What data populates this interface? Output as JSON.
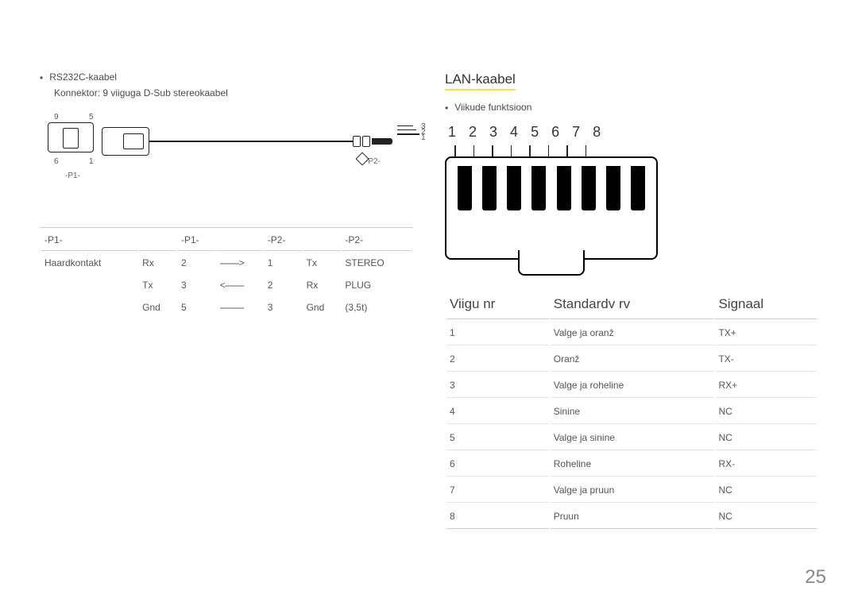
{
  "left": {
    "bullet1": "RS232C-kaabel",
    "sub1": "Konnektor: 9 viiguga D-Sub stereokaabel",
    "diagram": {
      "n9": "9",
      "n5": "5",
      "n6": "6",
      "n1": "1",
      "p1": "-P1-",
      "p2": "-P2-",
      "lead3": "3",
      "lead2": "2",
      "lead1": "1"
    },
    "pin_headers": [
      "-P1-",
      "",
      "-P1-",
      "",
      "-P2-",
      "",
      "-P2-"
    ],
    "pin_rows": [
      [
        "Haardkontakt",
        "Rx",
        "2",
        "-------->",
        "1",
        "Tx",
        "STEREO"
      ],
      [
        "",
        "Tx",
        "3",
        "<--------",
        "2",
        "Rx",
        "PLUG"
      ],
      [
        "",
        "Gnd",
        "5",
        "----------",
        "3",
        "Gnd",
        "(3,5t)"
      ]
    ]
  },
  "right": {
    "title": "LAN-kaabel",
    "bullet1": "Viikude funktsioon",
    "pin_numbers": [
      "1",
      "2",
      "3",
      "4",
      "5",
      "6",
      "7",
      "8"
    ],
    "table_headers": [
      "Viigu nr",
      "Standardv rv",
      "Signaal"
    ],
    "rows": [
      [
        "1",
        "Valge ja oranž",
        "TX+"
      ],
      [
        "2",
        "Oranž",
        "TX-"
      ],
      [
        "3",
        "Valge ja roheline",
        "RX+"
      ],
      [
        "4",
        "Sinine",
        "NC"
      ],
      [
        "5",
        "Valge ja sinine",
        "NC"
      ],
      [
        "6",
        "Roheline",
        "RX-"
      ],
      [
        "7",
        "Valge ja pruun",
        "NC"
      ],
      [
        "8",
        "Pruun",
        "NC"
      ]
    ]
  },
  "page_number": "25"
}
